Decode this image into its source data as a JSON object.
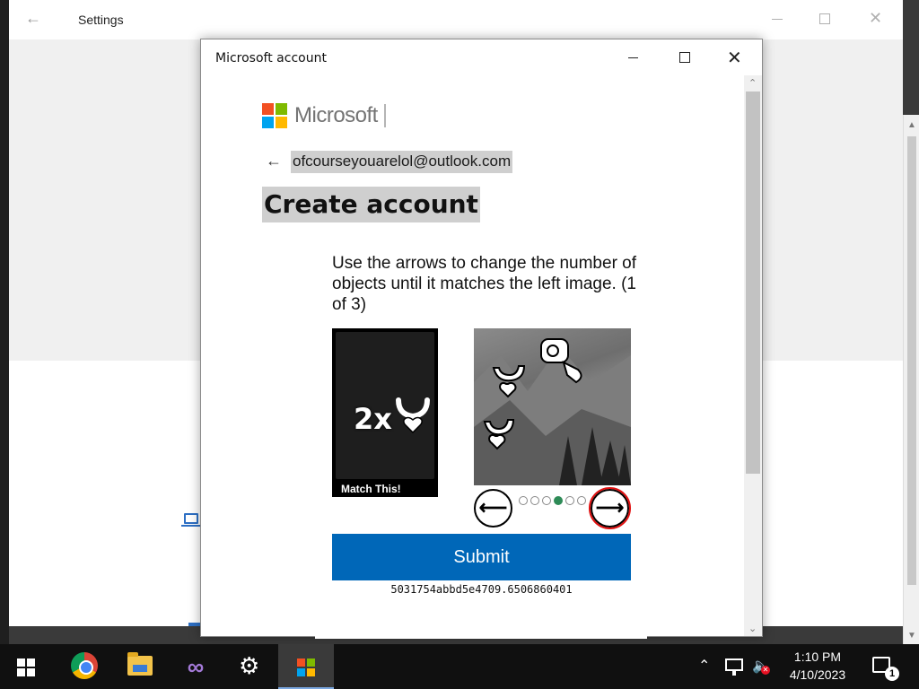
{
  "settings_window": {
    "title": "Settings",
    "back_icon": "back-arrow-icon"
  },
  "dialog": {
    "title": "Microsoft account",
    "brand": {
      "wordmark": "Microsoft",
      "logo_colors": [
        "#f25022",
        "#7fba00",
        "#00a4ef",
        "#ffb900"
      ]
    },
    "email": "ofcourseyouarelol@outlook.com",
    "heading": "Create account",
    "captcha": {
      "instruction": "Use the arrows to change the number of objects until it matches the left image. (1 of 3)",
      "target_count_label": "2x",
      "target_caption": "Match This!",
      "dots_total": 6,
      "dots_active_index": 3,
      "prev_icon": "arrow-left-icon",
      "next_icon": "arrow-right-icon",
      "submit_label": "Submit",
      "session_id": "5031754abbd5e4709.6506860401"
    }
  },
  "taskbar": {
    "apps": [
      {
        "name": "Start",
        "icon": "windows-logo-icon"
      },
      {
        "name": "Google Chrome",
        "icon": "chrome-icon"
      },
      {
        "name": "File Explorer",
        "icon": "folder-icon"
      },
      {
        "name": "Visual Studio",
        "icon": "visual-studio-icon"
      },
      {
        "name": "Settings",
        "icon": "gear-icon"
      },
      {
        "name": "Microsoft account",
        "icon": "microsoft-logo-icon",
        "active": true
      }
    ],
    "clock": {
      "time": "1:10 PM",
      "date": "4/10/2023"
    },
    "notification_count": "1"
  },
  "colors": {
    "submit_blue": "#0067b8",
    "dot_active": "#2e8b57",
    "focus_outline": "#e01010"
  }
}
